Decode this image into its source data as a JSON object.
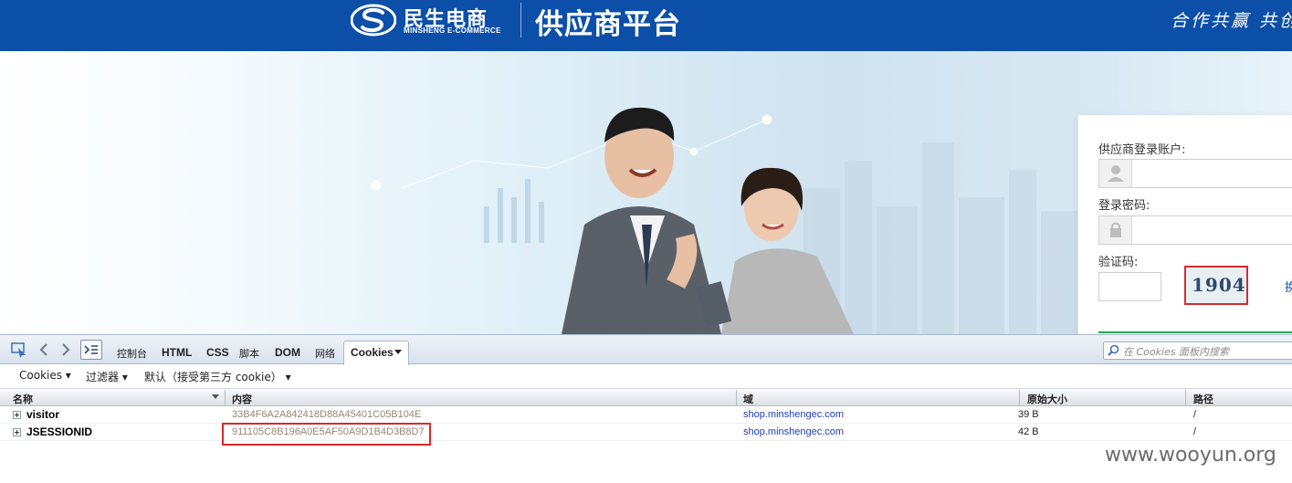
{
  "brand": {
    "name_cn": "民生电商",
    "name_en": "MINSHENG E-COMMERCE",
    "platform_title": "供应商平台",
    "slogan": "合作共赢 共创"
  },
  "login": {
    "account_label": "供应商登录账户:",
    "password_label": "登录密码:",
    "captcha_label": "验证码:",
    "captcha_value": "1904",
    "refresh_link": "换"
  },
  "firebug": {
    "tabs": [
      "控制台",
      "HTML",
      "CSS",
      "脚本",
      "DOM",
      "网络",
      "Cookies"
    ],
    "active_tab": "Cookies",
    "search_placeholder": "在 Cookies 面板内搜索",
    "submenu": {
      "cookies": "Cookies",
      "filter": "过滤器",
      "default_policy": "默认（接受第三方 cookie）"
    },
    "columns": {
      "name": "名称",
      "content": "内容",
      "domain": "域",
      "raw_size": "原始大小",
      "path": "路径"
    },
    "rows": [
      {
        "name": "visitor",
        "value": "33B4F6A2A842418D88A45401C05B104E",
        "domain": "shop.minshengec.com",
        "size": "39 B",
        "path": "/"
      },
      {
        "name": "JSESSIONID",
        "value": "911105C8B196A0E5AF50A9D1B4D3B8D7",
        "domain": "shop.minshengec.com",
        "size": "42 B",
        "path": "/"
      }
    ]
  },
  "watermark": "www.wooyun.org",
  "colors": {
    "brand_blue": "#0b4fa8",
    "highlight_red": "#d9292b",
    "domain_link": "#1c3fb5",
    "login_green": "#2aa94d"
  }
}
